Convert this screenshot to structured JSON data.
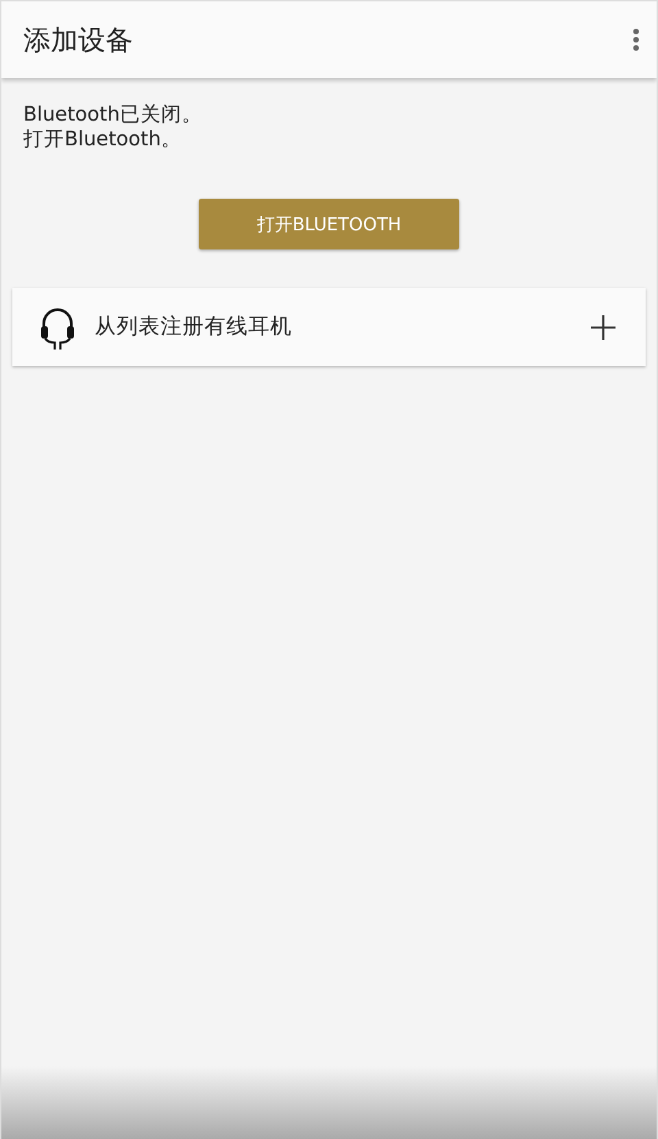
{
  "app_bar": {
    "title": "添加设备"
  },
  "message": [
    "Bluetooth已关闭。",
    "打开Bluetooth。"
  ],
  "primary_button": {
    "label": "打开BLUETOOTH"
  },
  "list_items": [
    {
      "kind": "headphones",
      "label": "从列表注册有线耳机"
    }
  ]
}
